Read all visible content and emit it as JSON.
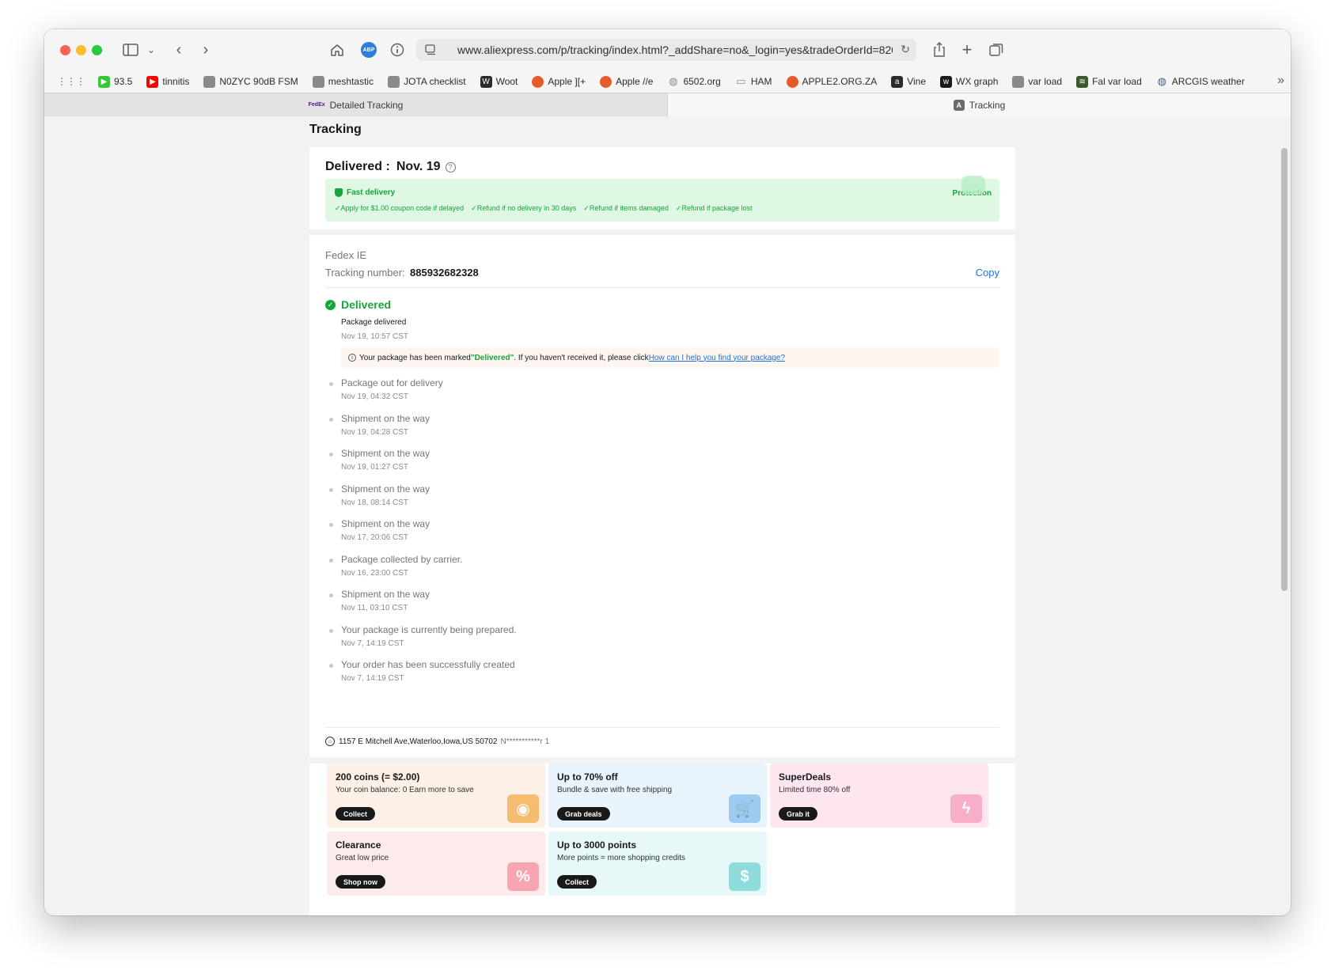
{
  "browser": {
    "url": "www.aliexpress.com/p/tracking/index.html?_addShare=no&_login=yes&tradeOrderId=8206",
    "adblock_label": "ABP"
  },
  "bookmarks": [
    {
      "label": "93.5",
      "icon": "play-icon",
      "color": "#37c837"
    },
    {
      "label": "tinnitis",
      "icon": "youtube-icon",
      "color": "#ff0000"
    },
    {
      "label": "N0ZYC 90dB FSM",
      "icon": "page-icon",
      "color": "#8a8a8a"
    },
    {
      "label": "meshtastic",
      "icon": "page-icon",
      "color": "#8a8a8a"
    },
    {
      "label": "JOTA checklist",
      "icon": "page-icon",
      "color": "#8a8a8a"
    },
    {
      "label": "Woot",
      "icon": "woot-icon",
      "color": "#2b2b2b"
    },
    {
      "label": "Apple ][+",
      "icon": "apple-icon",
      "color": "#e65b2a"
    },
    {
      "label": "Apple //e",
      "icon": "apple-icon",
      "color": "#e65b2a"
    },
    {
      "label": "6502.org",
      "icon": "globe-icon",
      "color": "#8a8a8a"
    },
    {
      "label": "HAM",
      "icon": "folder-icon",
      "color": "#8a8a8a"
    },
    {
      "label": "APPLE2.ORG.ZA",
      "icon": "apple-icon",
      "color": "#e65b2a"
    },
    {
      "label": "Vine",
      "icon": "amazon-icon",
      "color": "#2b2b2b"
    },
    {
      "label": "WX graph",
      "icon": "wu-icon",
      "color": "#1a1a1a"
    },
    {
      "label": "var load",
      "icon": "page-icon",
      "color": "#8a8a8a"
    },
    {
      "label": "Fal var load",
      "icon": "radar-icon",
      "color": "#3b5b2b"
    },
    {
      "label": "ARCGIS weather",
      "icon": "globe-icon",
      "color": "#2f6a9e"
    }
  ],
  "tabs": [
    {
      "label": "Detailed Tracking",
      "icon": "FedEx"
    },
    {
      "label": "Tracking",
      "icon": "A"
    }
  ],
  "page": {
    "title": "Tracking",
    "delivered_label": "Delivered :",
    "delivered_date": "Nov. 19",
    "protection": {
      "fast_label": "Fast delivery",
      "title": "Protection",
      "perks": [
        "Apply for $1.00 coupon code if delayed",
        "Refund if no delivery in 30 days",
        "Refund if items damaged",
        "Refund if package lost"
      ]
    },
    "carrier": "Fedex IE",
    "tracking_label": "Tracking number:",
    "tracking_number": "885932682328",
    "copy_label": "Copy",
    "status": "Delivered",
    "latest": {
      "title": "Package delivered",
      "time": "Nov 19, 10:57 CST"
    },
    "notice": {
      "pre": "Your package has been marked ",
      "highlight": "\"Delivered\"",
      "post": ". If you haven't received it, please click ",
      "link": "How can I help you find your package?"
    },
    "events": [
      {
        "title": "Package out for delivery",
        "time": "Nov 19, 04:32 CST"
      },
      {
        "title": "Shipment on the way",
        "time": "Nov 19, 04:28 CST"
      },
      {
        "title": "Shipment on the way",
        "time": "Nov 19, 01:27 CST"
      },
      {
        "title": "Shipment on the way",
        "time": "Nov 18, 08:14 CST"
      },
      {
        "title": "Shipment on the way",
        "time": "Nov 17, 20:06 CST"
      },
      {
        "title": "Package collected by carrier.",
        "time": "Nov 16, 23:00 CST"
      },
      {
        "title": "Shipment on the way",
        "time": "Nov 11, 03:10 CST"
      },
      {
        "title": "Your package is currently being prepared.",
        "time": "Nov 7, 14:19 CST"
      },
      {
        "title": "Your order has been successfully created",
        "time": "Nov 7, 14:19 CST"
      }
    ],
    "address": "1157 E Mitchell Ave,Waterloo,Iowa,US 50702",
    "recipient": "N***********r 1"
  },
  "promos": [
    {
      "title": "200 coins  (= $2.00)",
      "sub": "Your coin balance: 0 Earn more to save",
      "btn": "Collect",
      "bg": "#fdf0e6",
      "art": "#f3b45a",
      "glyph": "◉"
    },
    {
      "title": "Up to 70% off",
      "sub": "Bundle & save with free shipping",
      "btn": "Grab deals",
      "bg": "#e8f3fc",
      "art": "#8fc3f0",
      "glyph": "🛒"
    },
    {
      "title": "SuperDeals",
      "sub": "Limited time 80% off",
      "btn": "Grab it",
      "bg": "#fde6ef",
      "art": "#f6a6c3",
      "glyph": "ϟ"
    },
    {
      "title": "Clearance",
      "sub": "Great low price",
      "btn": "Shop now",
      "bg": "#fdeaea",
      "art": "#f59aa8",
      "glyph": "%"
    },
    {
      "title": "Up to 3000 points",
      "sub": "More points = more shopping credits",
      "btn": "Collect",
      "bg": "#e6f9f8",
      "art": "#7fd6d8",
      "glyph": "$"
    }
  ]
}
